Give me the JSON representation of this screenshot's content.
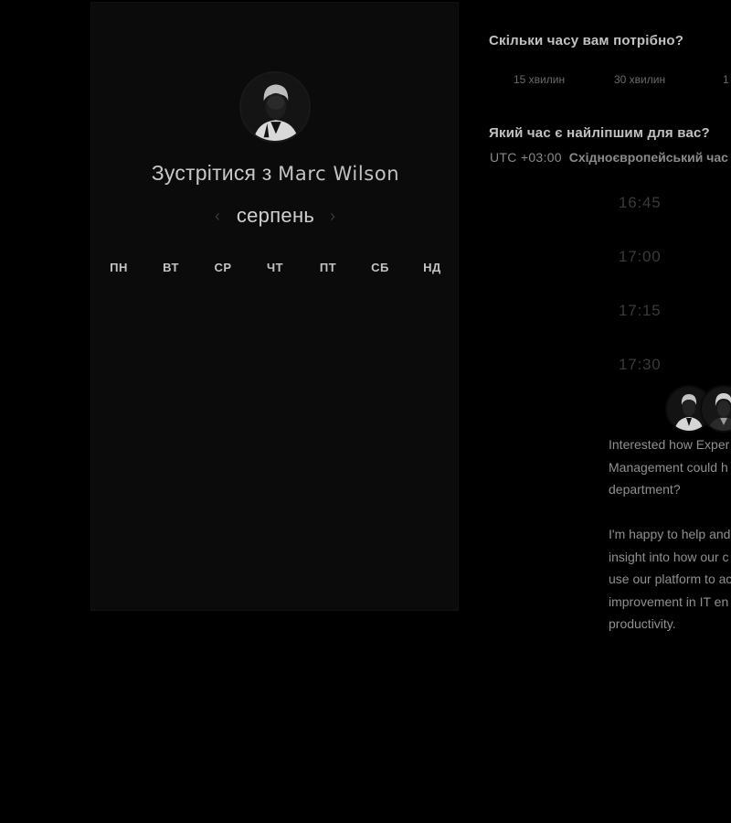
{
  "host": {
    "greeting": "Зустрітися з",
    "name": "Marc Wilson"
  },
  "calendar": {
    "month_label": "серпень",
    "prev_icon": "chevron-left-icon",
    "next_icon": "chevron-right-icon",
    "weekdays": [
      "ПН",
      "ВТ",
      "СР",
      "ЧТ",
      "ПТ",
      "СБ",
      "НД"
    ],
    "weeks": [
      [
        "",
        "",
        "",
        "",
        "",
        "",
        ""
      ],
      [
        "",
        "",
        "",
        "",
        "",
        "",
        ""
      ],
      [
        "",
        "",
        "",
        "",
        "",
        "",
        ""
      ],
      [
        "",
        "",
        "",
        "",
        "",
        "",
        ""
      ],
      [
        "",
        "",
        "",
        "",
        "",
        "",
        ""
      ]
    ]
  },
  "duration": {
    "question": "Скільки часу вам потрібно?",
    "options": [
      "15 хвилин",
      "30 хвилин",
      "1"
    ]
  },
  "time": {
    "question": "Який час є найліпшим для вас?",
    "tz_offset": "UTC +03:00",
    "tz_name": "Східноєвропейський час",
    "slots": [
      "16:45",
      "17:00",
      "17:15",
      "17:30"
    ]
  },
  "intro": {
    "paragraph_1": "Interested how Exper\nManagement could h\ndepartment?",
    "paragraph_2": "I'm happy to help and\ninsight into how our c\nuse our platform to ac\nimprovement in IT en\nproductivity."
  },
  "colors": {
    "background": "#000000",
    "card": "#0b0b0b",
    "text": "#c8c8c8",
    "muted": "#3a3a3a"
  }
}
